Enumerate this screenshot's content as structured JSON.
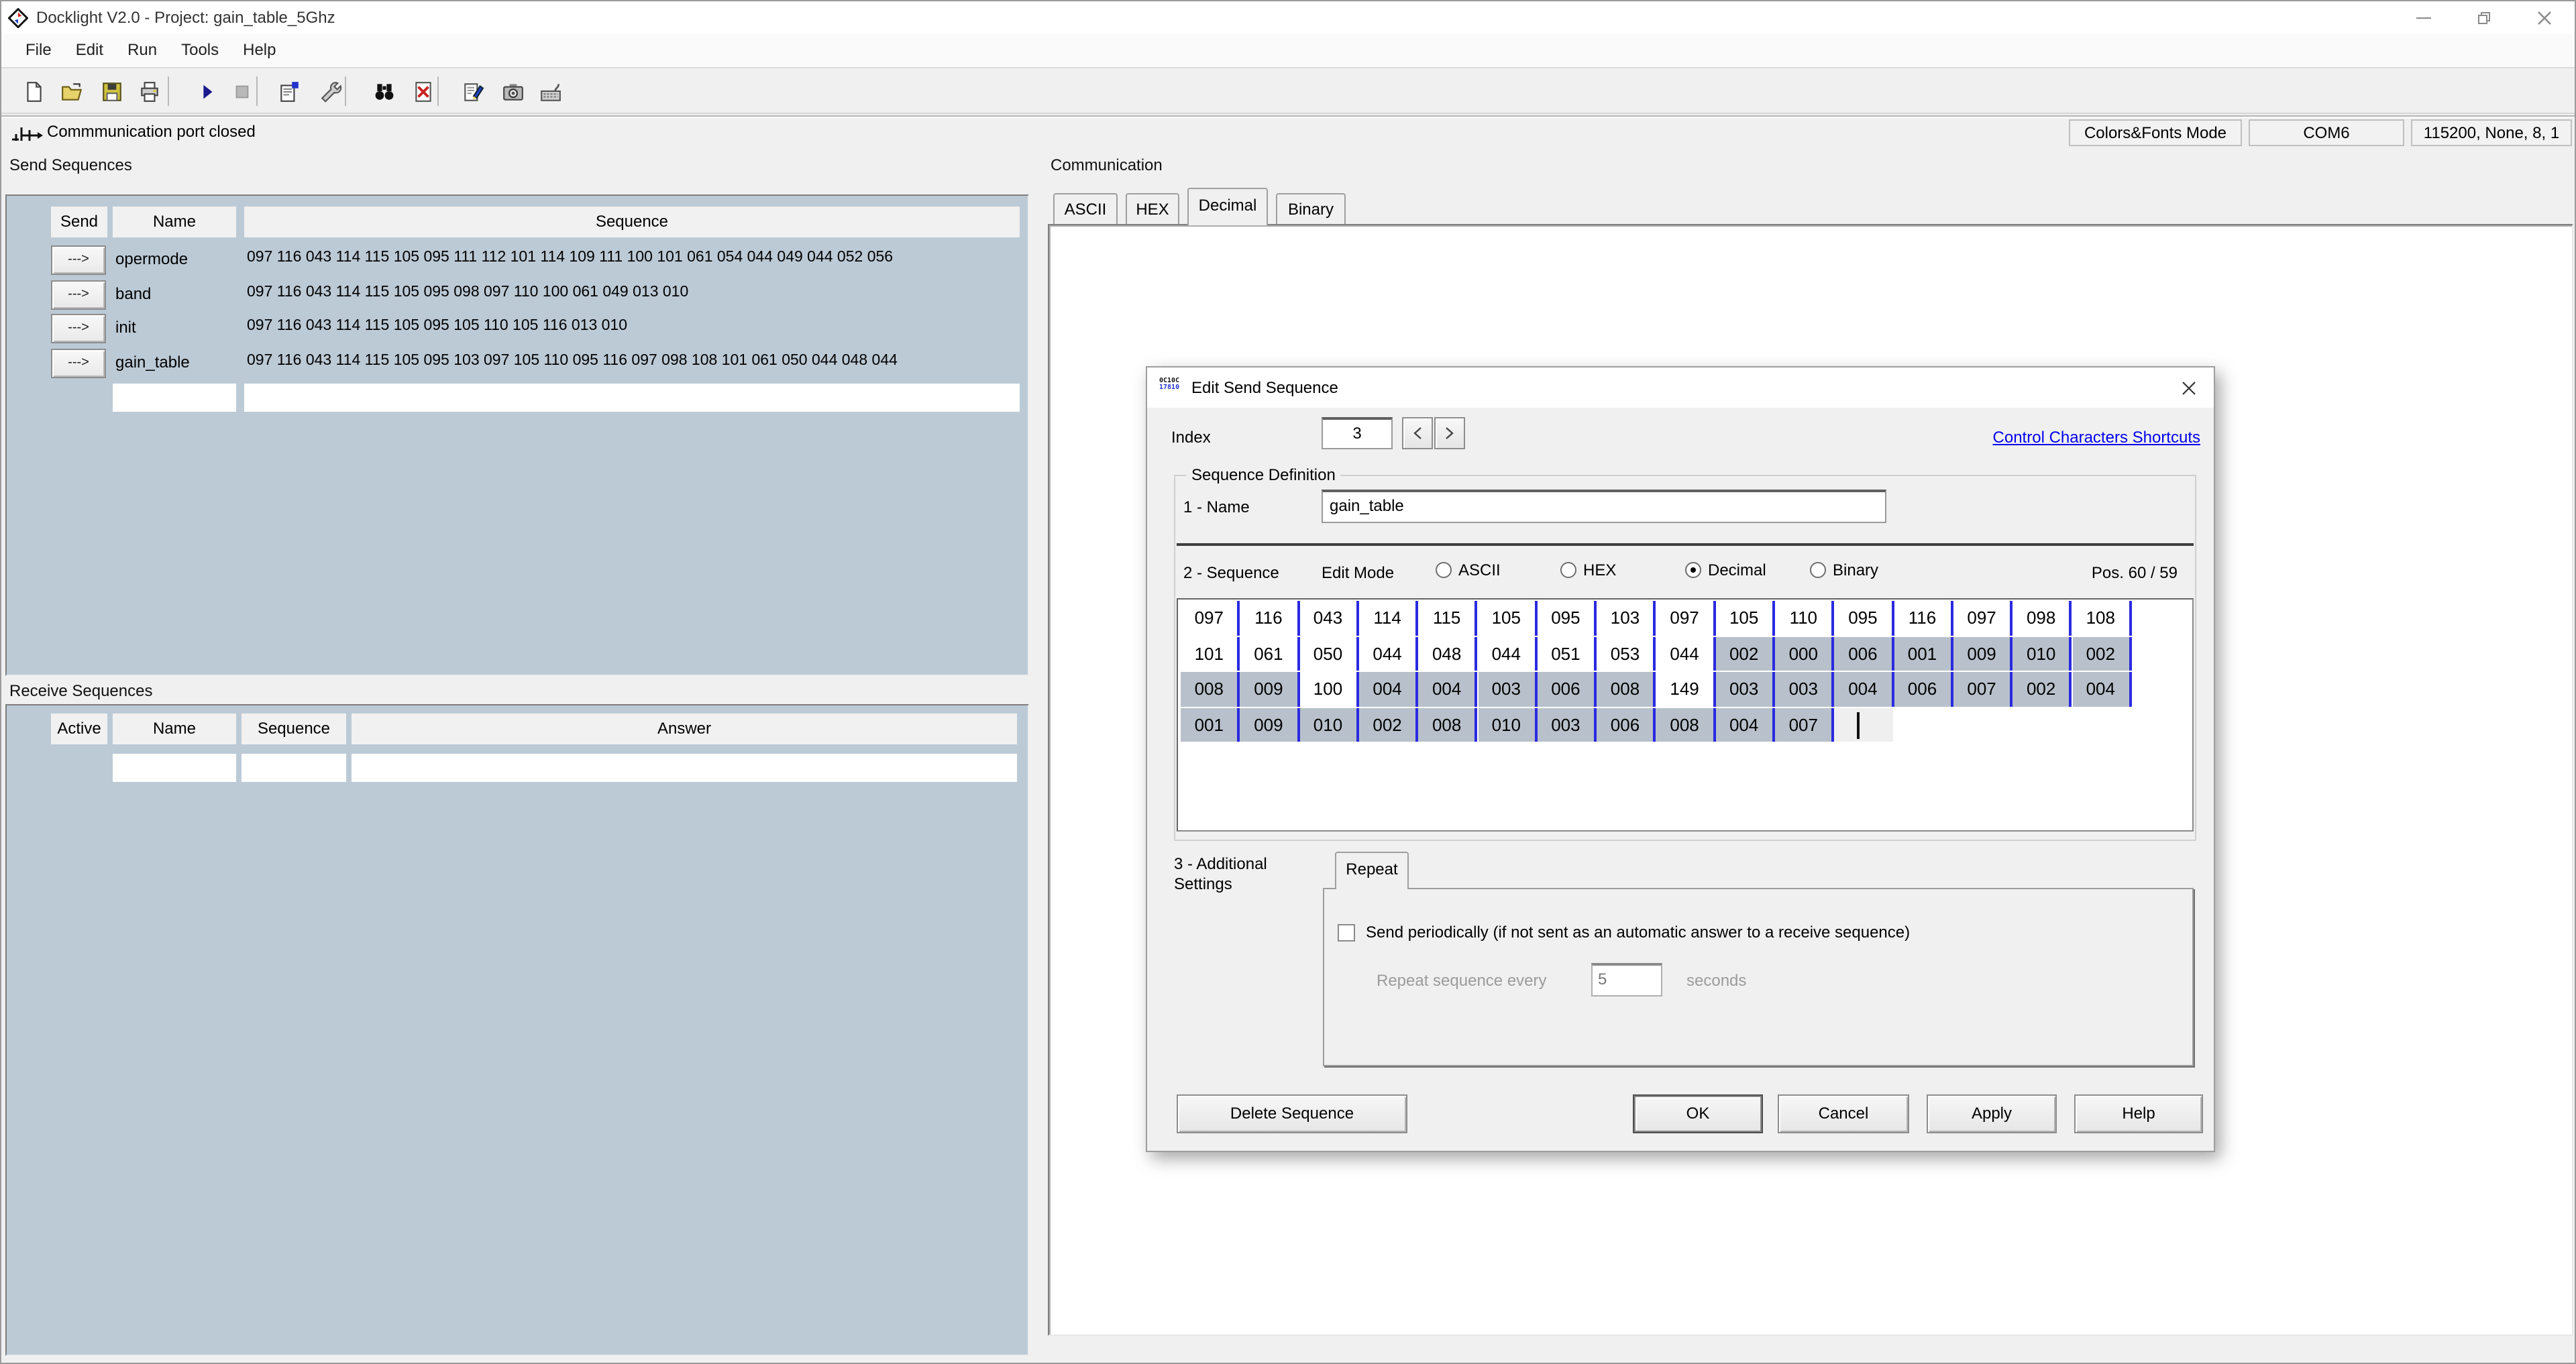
{
  "window": {
    "title": "Docklight V2.0 - Project: gain_table_5Ghz"
  },
  "menu": {
    "items": [
      "File",
      "Edit",
      "Run",
      "Tools",
      "Help"
    ]
  },
  "toolbar": {
    "buttons": [
      "new-project",
      "open-project",
      "save-project",
      "print",
      "start-communication",
      "stop-communication",
      "project-settings",
      "options",
      "find-sequence",
      "clear-communication-window",
      "edit-notes",
      "snapshot",
      "keyboard-console"
    ]
  },
  "statusbar": {
    "message": "Commmunication port closed",
    "mode": "Colors&Fonts Mode",
    "port": "COM6",
    "settings": "115200, None, 8, 1"
  },
  "send_sequences": {
    "title": "Send Sequences",
    "columns": [
      "Send",
      "Name",
      "Sequence"
    ],
    "send_button_label": "--->",
    "rows": [
      {
        "name": "opermode",
        "sequence": "097 116 043 114 115 105 095 111 112 101 114 109 111 100 101 061 054 044 049 044 052 056"
      },
      {
        "name": "band",
        "sequence": "097 116 043 114 115 105 095 098 097 110 100 061 049 013 010"
      },
      {
        "name": "init",
        "sequence": "097 116 043 114 115 105 095 105 110 105 116 013 010"
      },
      {
        "name": "gain_table",
        "sequence": "097 116 043 114 115 105 095 103 097 105 110 095 116 097 098 108 101 061 050 044 048 044"
      }
    ]
  },
  "receive_sequences": {
    "title": "Receive Sequences",
    "columns": [
      "Active",
      "Name",
      "Sequence",
      "Answer"
    ]
  },
  "communication": {
    "title": "Communication",
    "tabs": [
      "ASCII",
      "HEX",
      "Decimal",
      "Binary"
    ],
    "active_tab": "Decimal"
  },
  "dialog": {
    "title": "Edit Send Sequence",
    "index_label": "Index",
    "index_value": "3",
    "link": "Control Characters Shortcuts",
    "group_title": "Sequence Definition",
    "name_label": "1 - Name",
    "name_value": "gain_table",
    "sequence_label": "2 - Sequence",
    "edit_mode_label": "Edit Mode",
    "edit_modes": [
      "ASCII",
      "HEX",
      "Decimal",
      "Binary"
    ],
    "selected_mode": "Decimal",
    "pos_label": "Pos. 60 / 59",
    "grid_rows": [
      {
        "values": [
          "097",
          "116",
          "043",
          "114",
          "115",
          "105",
          "095",
          "103",
          "097",
          "105",
          "110",
          "095",
          "116",
          "097",
          "098",
          "108"
        ],
        "selected": [
          0,
          0,
          0,
          0,
          0,
          0,
          0,
          0,
          0,
          0,
          0,
          0,
          0,
          0,
          0,
          0
        ]
      },
      {
        "values": [
          "101",
          "061",
          "050",
          "044",
          "048",
          "044",
          "051",
          "053",
          "044",
          "002",
          "000",
          "006",
          "001",
          "009",
          "010",
          "002"
        ],
        "selected": [
          0,
          0,
          0,
          0,
          0,
          0,
          0,
          0,
          0,
          1,
          1,
          1,
          1,
          1,
          1,
          1
        ]
      },
      {
        "values": [
          "008",
          "009",
          "100",
          "004",
          "004",
          "003",
          "006",
          "008",
          "149",
          "003",
          "003",
          "004",
          "006",
          "007",
          "002",
          "004"
        ],
        "selected": [
          1,
          1,
          0,
          1,
          1,
          1,
          1,
          1,
          0,
          1,
          1,
          1,
          1,
          1,
          1,
          1
        ]
      },
      {
        "values": [
          "001",
          "009",
          "010",
          "002",
          "008",
          "010",
          "003",
          "006",
          "008",
          "004",
          "007"
        ],
        "selected": [
          1,
          1,
          1,
          1,
          1,
          1,
          1,
          1,
          1,
          1,
          1
        ],
        "caret_after": true
      }
    ],
    "additional_line1": "3 - Additional",
    "additional_line2": "Settings",
    "repeat_tab": "Repeat",
    "periodic_label": "Send periodically  (if not sent as an automatic answer to a receive sequence)",
    "repeat_prefix": "Repeat sequence every",
    "repeat_value": "5",
    "repeat_unit": "seconds",
    "buttons": {
      "delete": "Delete Sequence",
      "ok": "OK",
      "cancel": "Cancel",
      "apply": "Apply",
      "help": "Help"
    }
  },
  "colors": {
    "panel_blue": "#bccad6",
    "grid_selection": "#b8c1cb",
    "grid_separator_blue": "#2a2ae0",
    "link_blue": "#0000ee",
    "window_bg": "#f0f0f0"
  }
}
